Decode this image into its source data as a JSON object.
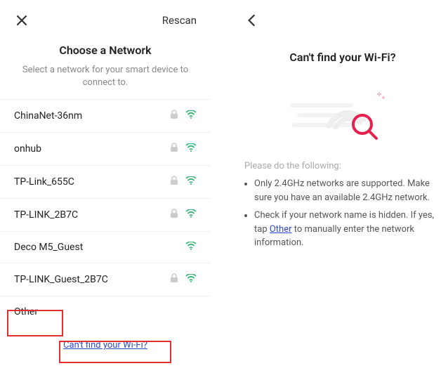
{
  "left": {
    "rescan": "Rescan",
    "title": "Choose a Network",
    "subtitle": "Select a network for your smart device to connect to.",
    "networks": [
      {
        "name": "ChinaNet-36nm",
        "locked": true,
        "signal": "strong"
      },
      {
        "name": "onhub",
        "locked": true,
        "signal": "strong"
      },
      {
        "name": "TP-Link_655C",
        "locked": true,
        "signal": "strong"
      },
      {
        "name": "TP-LINK_2B7C",
        "locked": true,
        "signal": "strong"
      },
      {
        "name": "Deco M5_Guest",
        "locked": false,
        "signal": "strong"
      },
      {
        "name": "TP-LINK_Guest_2B7C",
        "locked": true,
        "signal": "strong"
      }
    ],
    "other": "Other",
    "cant_find": "Can't find your Wi-Fi?"
  },
  "right": {
    "title": "Can't find your Wi-Fi?",
    "instructions_label": "Please do the following:",
    "bullet1": "Only 2.4GHz networks are supported. Make sure you have an available 2.4GHz network.",
    "bullet2a": "Check if your network name is hidden. If yes, tap ",
    "bullet2_link": "Other",
    "bullet2b": " to manually enter the network information."
  }
}
